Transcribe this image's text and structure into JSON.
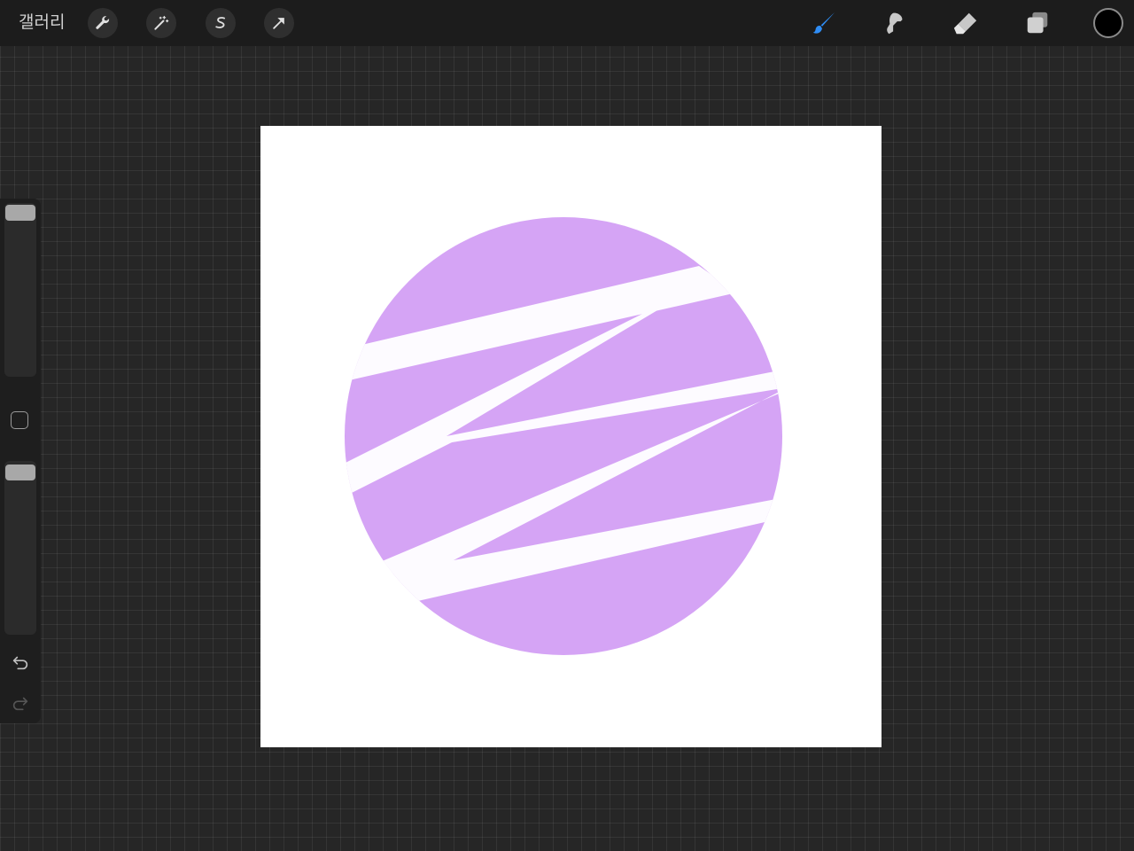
{
  "topbar": {
    "gallery_label": "갤러리",
    "left_tools": [
      {
        "name": "actions",
        "icon": "wrench-icon"
      },
      {
        "name": "adjustments",
        "icon": "magic-wand-icon"
      },
      {
        "name": "selection",
        "icon": "selection-s-icon"
      },
      {
        "name": "transform",
        "icon": "arrow-cursor-icon"
      }
    ],
    "right_tools": [
      {
        "name": "brush",
        "icon": "brush-icon",
        "active": true
      },
      {
        "name": "smudge",
        "icon": "smudge-icon",
        "active": false
      },
      {
        "name": "eraser",
        "icon": "eraser-icon",
        "active": false
      },
      {
        "name": "layers",
        "icon": "layers-icon",
        "active": false
      }
    ],
    "current_color": "#000000",
    "active_color": "#2f8df5",
    "inactive_color": "#c8c8c8"
  },
  "sidebar": {
    "brush_size_slider": {
      "value": 1.0
    },
    "opacity_slider": {
      "value": 1.0
    },
    "modify_button": "square-icon",
    "undo": "undo-icon",
    "redo": "redo-icon"
  },
  "canvas": {
    "background": "#ffffff",
    "circle_fill": "#d5a4f5",
    "stroke_color": "#fdfbff"
  }
}
